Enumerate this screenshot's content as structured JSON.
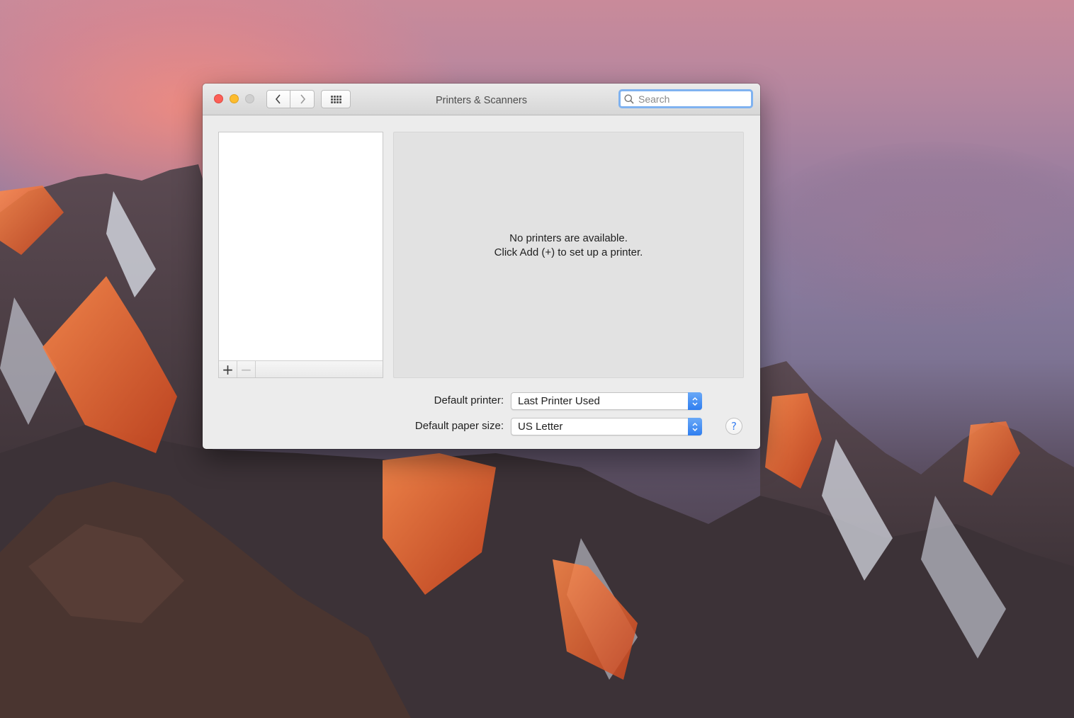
{
  "desktop": {
    "wallpaper_icon": "mountain-sunset-wallpaper"
  },
  "window": {
    "title": "Printers & Scanners",
    "controls": {
      "close_color": "#fc5f57",
      "minimize_color": "#fdbc2e",
      "zoom_color": "#cfcfcf"
    },
    "toolbar": {
      "back_icon": "chevron-left-icon",
      "forward_icon": "chevron-right-icon",
      "show_all_icon": "grid-icon"
    },
    "search": {
      "placeholder": "Search",
      "value": ""
    }
  },
  "printer_list": {
    "items": [],
    "add_label": "+",
    "remove_label": "−"
  },
  "detail": {
    "empty_line1": "No printers are available.",
    "empty_line2": "Click Add (+) to set up a printer."
  },
  "preferences": {
    "default_printer_label": "Default printer:",
    "default_printer_value": "Last Printer Used",
    "paper_size_label": "Default paper size:",
    "paper_size_value": "US Letter"
  },
  "help": {
    "label": "?"
  },
  "colors": {
    "accent": "#2f7ef0",
    "search_focus_ring": "#7fb2f0"
  }
}
